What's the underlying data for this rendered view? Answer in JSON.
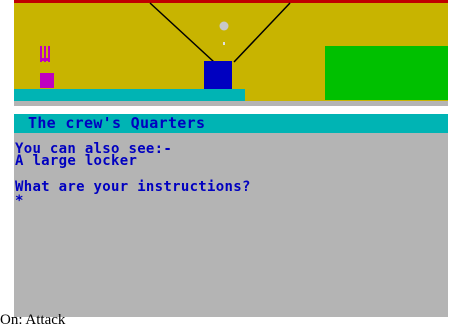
{
  "room": {
    "title": "The crew's Quarters"
  },
  "output": {
    "see_heading": "You can also see:-",
    "item_1": "A large locker",
    "prompt": "What are your instructions?",
    "cursor": "*"
  },
  "caption": "On: Attack",
  "colors": {
    "wall": "#c8b400",
    "ceiling_line": "#c00000",
    "beam": "#000000",
    "light_fixture": "#0000c0",
    "floor": "#00b4b4",
    "green_panel": "#00c000",
    "plant_stem": "#c000c0",
    "text": "#0000c0",
    "text_bg": "#b4b4b4"
  }
}
